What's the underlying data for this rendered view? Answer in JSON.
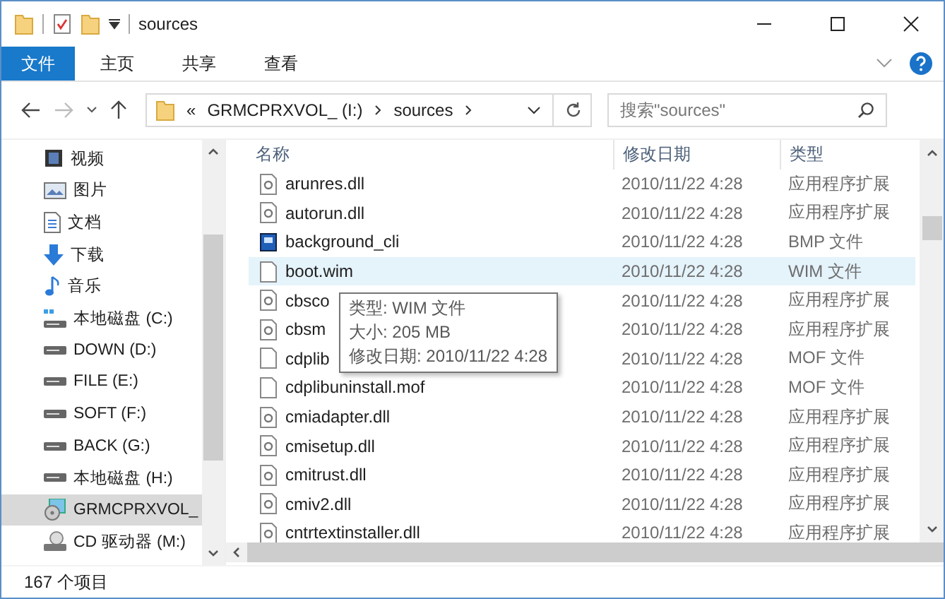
{
  "window": {
    "title": "sources"
  },
  "ribbon_tabs": [
    {
      "label": "文件",
      "selected": true
    },
    {
      "label": "主页",
      "selected": false
    },
    {
      "label": "共享",
      "selected": false
    },
    {
      "label": "查看",
      "selected": false
    }
  ],
  "address_bar": {
    "overflow": "«",
    "segments": [
      "GRMCPRXVOL_ (I:)",
      "sources"
    ]
  },
  "search": {
    "placeholder": "搜索\"sources\""
  },
  "sidebar": {
    "items": [
      {
        "label": "视频",
        "kind": "video",
        "selected": false
      },
      {
        "label": "图片",
        "kind": "picture",
        "selected": false
      },
      {
        "label": "文档",
        "kind": "document",
        "selected": false
      },
      {
        "label": "下载",
        "kind": "download",
        "selected": false
      },
      {
        "label": "音乐",
        "kind": "music",
        "selected": false
      },
      {
        "label": "本地磁盘 (C:)",
        "kind": "system-drive",
        "selected": false
      },
      {
        "label": "DOWN (D:)",
        "kind": "drive",
        "selected": false
      },
      {
        "label": "FILE (E:)",
        "kind": "drive",
        "selected": false
      },
      {
        "label": "SOFT (F:)",
        "kind": "drive",
        "selected": false
      },
      {
        "label": "BACK (G:)",
        "kind": "drive",
        "selected": false
      },
      {
        "label": "本地磁盘 (H:)",
        "kind": "drive",
        "selected": false
      },
      {
        "label": "GRMCPRXVOL_",
        "kind": "install-drive",
        "selected": true
      },
      {
        "label": "CD 驱动器 (M:)",
        "kind": "cd",
        "selected": false
      }
    ]
  },
  "file_list": {
    "columns": [
      "名称",
      "修改日期",
      "类型"
    ],
    "rows": [
      {
        "name": "arunres.dll",
        "date": "2010/11/22 4:28",
        "type": "应用程序扩展",
        "kind": "dll",
        "hovered": false
      },
      {
        "name": "autorun.dll",
        "date": "2010/11/22 4:28",
        "type": "应用程序扩展",
        "kind": "dll",
        "hovered": false
      },
      {
        "name": "background_cli",
        "date": "2010/11/22 4:28",
        "type": "BMP 文件",
        "kind": "image",
        "hovered": false
      },
      {
        "name": "boot.wim",
        "date": "2010/11/22 4:28",
        "type": "WIM 文件",
        "kind": "blank",
        "hovered": true
      },
      {
        "name": "cbsco",
        "date": "2010/11/22 4:28",
        "type": "应用程序扩展",
        "kind": "dll",
        "hovered": false
      },
      {
        "name": "cbsm",
        "date": "2010/11/22 4:28",
        "type": "应用程序扩展",
        "kind": "dll",
        "hovered": false
      },
      {
        "name": "cdplib",
        "date": "2010/11/22 4:28",
        "type": "MOF 文件",
        "kind": "blank",
        "hovered": false
      },
      {
        "name": "cdplibuninstall.mof",
        "date": "2010/11/22 4:28",
        "type": "MOF 文件",
        "kind": "blank",
        "hovered": false
      },
      {
        "name": "cmiadapter.dll",
        "date": "2010/11/22 4:28",
        "type": "应用程序扩展",
        "kind": "dll",
        "hovered": false
      },
      {
        "name": "cmisetup.dll",
        "date": "2010/11/22 4:28",
        "type": "应用程序扩展",
        "kind": "dll",
        "hovered": false
      },
      {
        "name": "cmitrust.dll",
        "date": "2010/11/22 4:28",
        "type": "应用程序扩展",
        "kind": "dll",
        "hovered": false
      },
      {
        "name": "cmiv2.dll",
        "date": "2010/11/22 4:28",
        "type": "应用程序扩展",
        "kind": "dll",
        "hovered": false
      },
      {
        "name": "cntrtextinstaller.dll",
        "date": "2010/11/22 4:28",
        "type": "应用程序扩展",
        "kind": "dll",
        "hovered": false
      }
    ]
  },
  "tooltip": {
    "lines": [
      "类型: WIM 文件",
      "大小: 205 MB",
      "修改日期: 2010/11/22 4:28"
    ]
  },
  "status_bar": {
    "item_count": "167 个项目"
  }
}
